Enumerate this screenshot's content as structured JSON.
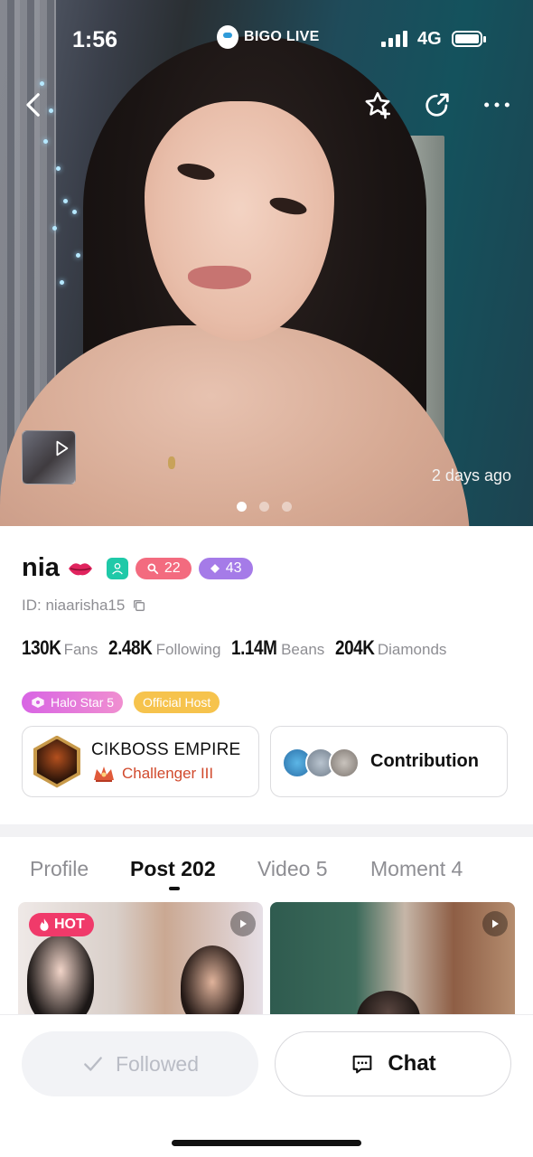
{
  "status_bar": {
    "time": "1:56",
    "app_name": "BIGO LIVE",
    "network": "4G"
  },
  "hero": {
    "posted_ago": "2 days ago",
    "slide_count": 3,
    "active_slide": 1
  },
  "profile": {
    "name": "nia",
    "level": "22",
    "diamond_level": "43",
    "id_text": "ID: niaarisha15",
    "stats": [
      {
        "value": "130K",
        "label": "Fans"
      },
      {
        "value": "2.48K",
        "label": "Following"
      },
      {
        "value": "1.14M",
        "label": "Beans"
      },
      {
        "value": "204K",
        "label": "Diamonds"
      }
    ],
    "tags": {
      "halo": "Halo Star 5",
      "official": "Official Host"
    },
    "family": {
      "name": "CIKBOSS EMPIRE",
      "rank": "Challenger III"
    },
    "contribution_label": "Contribution"
  },
  "tabs": [
    {
      "label": "Profile"
    },
    {
      "label": "Post 202"
    },
    {
      "label": "Video 5"
    },
    {
      "label": "Moment 4"
    }
  ],
  "active_tab": "Post 202",
  "posts": {
    "hot_label": "HOT"
  },
  "actions": {
    "followed_label": "Followed",
    "chat_label": "Chat"
  },
  "colors": {
    "accent_pink": "#f03a6a",
    "teal": "#1fc9a8",
    "level_red": "#f36b7f",
    "diamond_purple": "#a57be8",
    "official_gold": "#f6c34d"
  }
}
